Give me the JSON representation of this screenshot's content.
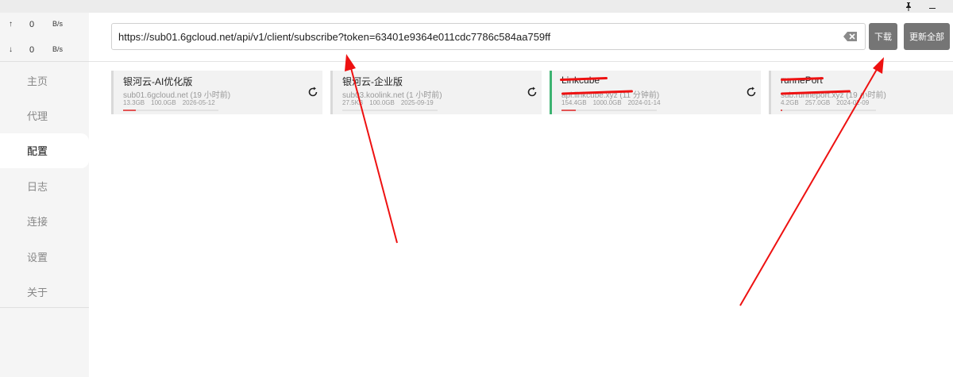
{
  "window": {
    "pin_icon": "pin-icon",
    "minimize_icon": "minimize-icon"
  },
  "traffic": {
    "up": {
      "arrow": "↑",
      "value": "0",
      "unit": "B/s"
    },
    "down": {
      "arrow": "↓",
      "value": "0",
      "unit": "B/s"
    }
  },
  "sidebar": {
    "items": [
      {
        "label": "主页"
      },
      {
        "label": "代理"
      },
      {
        "label": "配置"
      },
      {
        "label": "日志"
      },
      {
        "label": "连接"
      },
      {
        "label": "设置"
      },
      {
        "label": "关于"
      }
    ],
    "active_index": 2
  },
  "toolbar": {
    "url_value": "https://sub01.6gcloud.net/api/v1/client/subscribe?token=63401e9364e011cdc7786c584aa759ff",
    "download_label": "下载",
    "update_all_label": "更新全部"
  },
  "profiles": [
    {
      "name": "银河云-AI优化版",
      "url": "sub01.6gcloud.net (19 小时前)",
      "used": "13.3GB",
      "total": "100.0GB",
      "expire": "2026-05-12",
      "usage_fraction": 0.133,
      "has_refresh": true,
      "selected": false
    },
    {
      "name": "银河云-企业版",
      "url": "sub03.koolink.net (1 小时前)",
      "used": "27.5KB",
      "total": "100.0GB",
      "expire": "2025-09-19",
      "usage_fraction": 0.0,
      "has_refresh": true,
      "selected": false
    },
    {
      "name": "Linkcube",
      "url": "api.linkcube.xyz (11 分钟前)",
      "used": "154.4GB",
      "total": "1000.0GB",
      "expire": "2024-01-14",
      "usage_fraction": 0.154,
      "has_refresh": true,
      "selected": true
    },
    {
      "name": "runnePort",
      "url": "sub.runneport.xyz (19 小时前)",
      "used": "4.2GB",
      "total": "257.0GB",
      "expire": "2024-02-09",
      "usage_fraction": 0.016,
      "has_refresh": false,
      "selected": false
    }
  ],
  "colors": {
    "accent_selected": "#3cb371",
    "usage_bar": "#e35555",
    "button_bg": "#757575",
    "annotation_arrow": "#ee1111"
  }
}
